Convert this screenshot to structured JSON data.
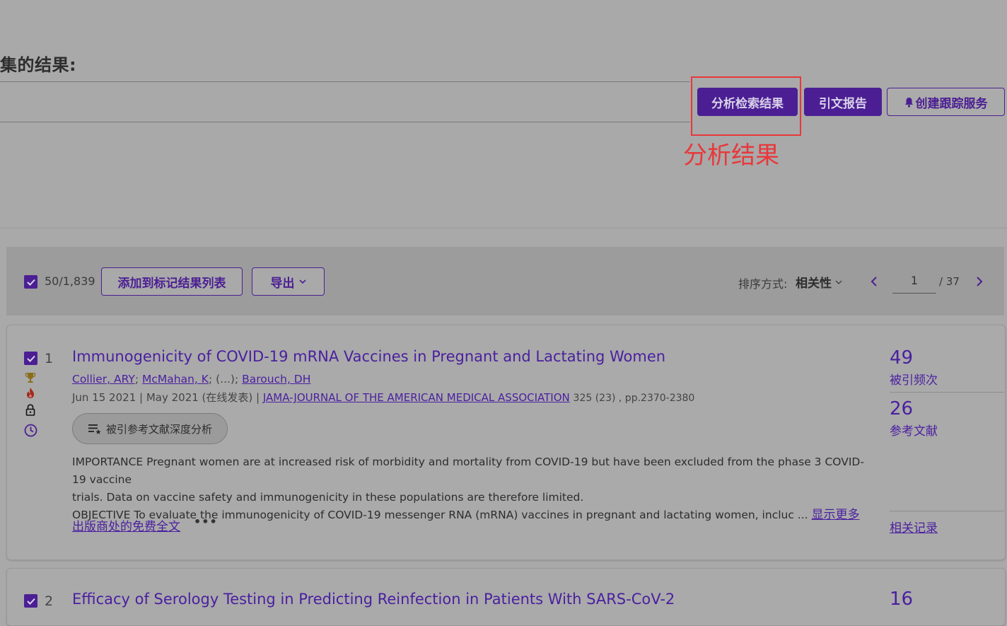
{
  "header": {
    "results_heading": "集的结果:"
  },
  "actions": {
    "analyze_label": "分析检索结果",
    "citation_report_label": "引文报告",
    "create_alert_label": "创建跟踪服务"
  },
  "annotation": {
    "label": "分析结果",
    "color": "#e8383b"
  },
  "toolbar": {
    "selected_count": "50/1,839",
    "add_to_list_label": "添加到标记结果列表",
    "export_label": "导出",
    "sort_prefix": "排序方式:",
    "sort_value": "相关性",
    "current_page": "1",
    "total_pages": "/ 37"
  },
  "records": [
    {
      "number": "1",
      "title": "Immunogenicity of COVID-19 mRNA Vaccines in Pregnant and Lactating Women",
      "authors": [
        "Collier, ARY",
        "McMahan, K",
        "Barouch, DH"
      ],
      "author_sep1": ";",
      "author_sep2": "; (...);",
      "date_info": "Jun 15 2021 | May 2021 (在线发表) |",
      "journal": "JAMA-JOURNAL OF THE AMERICAN MEDICAL ASSOCIATION",
      "volume_pages": "325 (23) , pp.2370-2380",
      "deep_analysis_label": "被引参考文献深度分析",
      "abstract_line1": "IMPORTANCE Pregnant women are at increased risk of morbidity and mortality from COVID-19 but have been excluded from the phase 3 COVID-19 vaccine",
      "abstract_line2": "trials. Data on vaccine safety and immunogenicity in these populations are therefore limited.",
      "abstract_line3": "OBJECTIVE To evaluate the immunogenicity of COVID-19 messenger RNA (mRNA) vaccines in pregnant and lactating women, incluc ...",
      "show_more_label": "显示更多",
      "free_full_text_label": "出版商处的免费全文",
      "more_label": "•••",
      "times_cited": "49",
      "times_cited_label": "被引频次",
      "references": "26",
      "references_label": "参考文献",
      "related_label": "相关记录"
    },
    {
      "number": "2",
      "title": "Efficacy of Serology Testing in Predicting Reinfection in Patients With SARS-CoV-2",
      "times_cited": "16"
    }
  ],
  "colors": {
    "brand_purple": "#4b1f93",
    "link_purple": "#4a1fa0",
    "overlay_gray": "#a9a9a9"
  }
}
